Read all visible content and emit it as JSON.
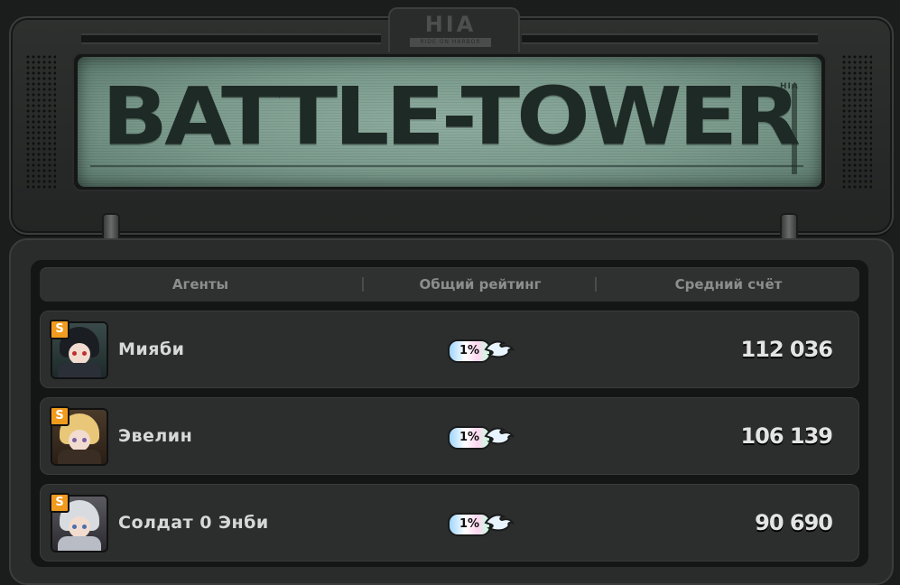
{
  "console": {
    "logo": "HIA",
    "logo_sub": "RIDE ON HARBOR",
    "title": "BATTLE-TOWER",
    "meter_label": "HIA"
  },
  "table": {
    "headers": [
      "Агенты",
      "Общий рейтинг",
      "Средний счёт"
    ],
    "rows": [
      {
        "rank": "S",
        "name": "Мияби",
        "rating": "1%",
        "score": "112 036",
        "avatar_theme": "dark-hair"
      },
      {
        "rank": "S",
        "name": "Эвелин",
        "rating": "1%",
        "score": "106 139",
        "avatar_theme": "blonde-hair"
      },
      {
        "rank": "S",
        "name": "Солдат 0 Энби",
        "rating": "1%",
        "score": "90 690",
        "avatar_theme": "white-hair"
      }
    ]
  },
  "colors": {
    "rank_badge": "#f09a1e",
    "screen": "#7a9a8c",
    "panel": "#2c2e2e"
  }
}
